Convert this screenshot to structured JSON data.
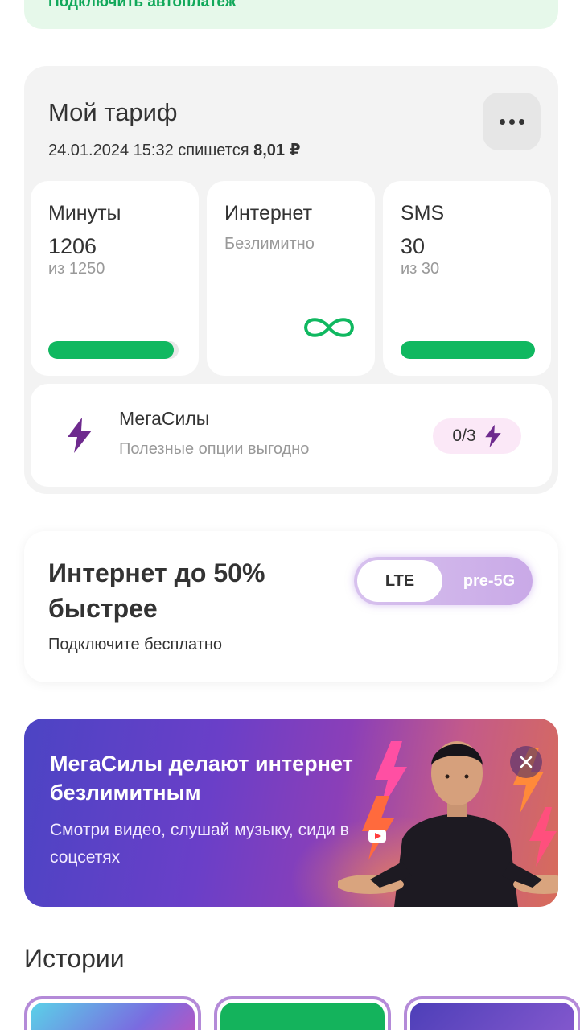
{
  "autopay": {
    "label": "Подключить автоплатеж"
  },
  "tariff": {
    "title": "Мой тариф",
    "charge_prefix": "24.01.2024 15:32 спишется",
    "charge_amount": "8,01 ₽",
    "tiles": [
      {
        "label": "Минуты",
        "value": "1206",
        "sub": "из 1250",
        "progress": 0.965
      },
      {
        "label": "Интернет",
        "status": "Безлимитно"
      },
      {
        "label": "SMS",
        "value": "30",
        "sub": "из 30",
        "progress": 1.0
      }
    ],
    "megasily": {
      "title": "МегаСилы",
      "subtitle": "Полезные опции выгодно",
      "counter": "0/3"
    }
  },
  "internet_promo": {
    "title": "Интернет до 50% быстрее",
    "subtitle": "Подключите бесплатно",
    "toggle_on": "LTE",
    "toggle_off": "pre-5G"
  },
  "banner": {
    "title": "МегаСилы делают интернет безлимитным",
    "subtitle": "Смотри видео, слушай музыку, сиди в соцсетях",
    "close": "×"
  },
  "stories": {
    "title": "Истории"
  },
  "colors": {
    "accent_green": "#10b860",
    "megasily_purple": "#6e2a8e",
    "toggle_purple": "#c9a9e7"
  },
  "icons": [
    "more-icon",
    "infinity-icon",
    "lightning-icon",
    "close-icon"
  ]
}
